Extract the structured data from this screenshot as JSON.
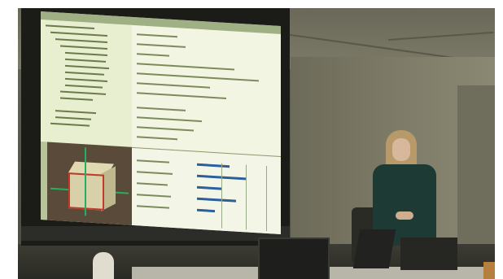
{
  "scene": {
    "description_hidden": false,
    "colors": {
      "wall": "#6c6a58",
      "projection": "#cfd8b2",
      "selection_highlight": "#c0392b",
      "axis_gizmo": "#27ae60",
      "presenter_top": "#1e3a34"
    },
    "icons": [
      "cube-model-icon",
      "axis-gizmo-icon"
    ]
  }
}
